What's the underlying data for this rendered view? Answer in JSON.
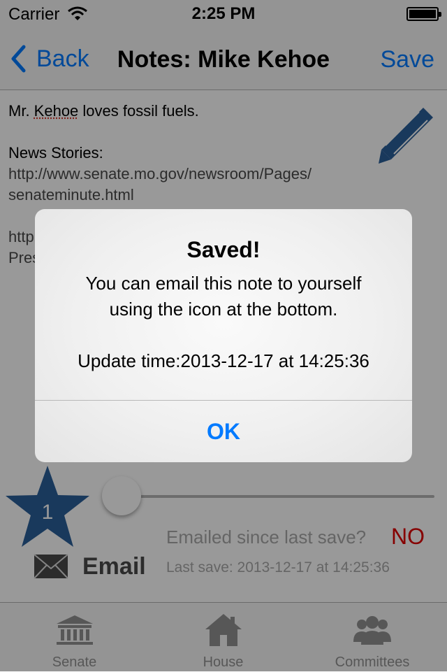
{
  "status_bar": {
    "carrier": "Carrier",
    "time": "2:25 PM"
  },
  "nav_bar": {
    "back_label": "Back",
    "title": "Notes: Mike Kehoe",
    "save_label": "Save"
  },
  "note": {
    "lines": [
      "Mr. Kehoe loves fossil fuels.",
      "",
      "News Stories:",
      "http://www.senate.mo.gov/newsroom/Pages/",
      "senateminute.html",
      "",
      "http",
      "Pres"
    ],
    "misspelled_word": "Kehoe"
  },
  "controls": {
    "star_count": "1",
    "emailed_label": "Emailed since last save?",
    "emailed_value": "NO",
    "email_label": "Email",
    "last_save": "Last save: 2013-12-17 at 14:25:36"
  },
  "tabs": [
    {
      "label": "Senate",
      "icon": "capitol-building-icon"
    },
    {
      "label": "House",
      "icon": "house-icon"
    },
    {
      "label": "Committees",
      "icon": "people-group-icon"
    }
  ],
  "alert": {
    "title": "Saved!",
    "message_lines": [
      "You can email this note to yourself",
      "using the icon at the bottom.",
      "",
      "Update time:2013-12-17 at 14:25:36"
    ],
    "ok_label": "OK"
  },
  "colors": {
    "accent": "#007aff",
    "star": "#2b5f99",
    "no_red": "#e00000",
    "dim_overlay": "rgba(0,0,0,0.40)"
  }
}
